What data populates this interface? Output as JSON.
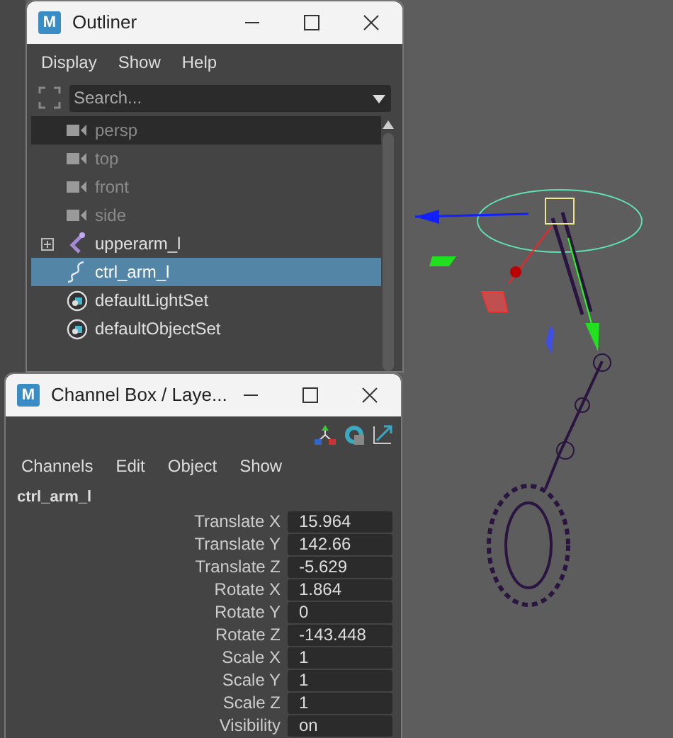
{
  "outliner": {
    "badge": "M",
    "title": "Outliner",
    "menu": [
      "Display",
      "Show",
      "Help"
    ],
    "search": {
      "placeholder": "Search..."
    },
    "items": [
      {
        "label": "persp",
        "kind": "camera",
        "hidden": true,
        "hovered": true,
        "selected": false,
        "collapsed": false
      },
      {
        "label": "top",
        "kind": "camera",
        "hidden": true,
        "hovered": false,
        "selected": false,
        "collapsed": false
      },
      {
        "label": "front",
        "kind": "camera",
        "hidden": true,
        "hovered": false,
        "selected": false,
        "collapsed": false
      },
      {
        "label": "side",
        "kind": "camera",
        "hidden": true,
        "hovered": false,
        "selected": false,
        "collapsed": false
      },
      {
        "label": "upperarm_l",
        "kind": "joint",
        "hidden": false,
        "hovered": false,
        "selected": false,
        "collapsed": true
      },
      {
        "label": "ctrl_arm_l",
        "kind": "curve",
        "hidden": false,
        "hovered": false,
        "selected": true,
        "collapsed": false
      },
      {
        "label": "defaultLightSet",
        "kind": "set",
        "hidden": false,
        "hovered": false,
        "selected": false,
        "collapsed": false
      },
      {
        "label": "defaultObjectSet",
        "kind": "set",
        "hidden": false,
        "hovered": false,
        "selected": false,
        "collapsed": false
      }
    ]
  },
  "channel_box": {
    "badge": "M",
    "title": "Channel Box / Laye...",
    "menu": [
      "Channels",
      "Edit",
      "Object",
      "Show"
    ],
    "node": "ctrl_arm_l",
    "channels": [
      {
        "name": "Translate X",
        "value": "15.964"
      },
      {
        "name": "Translate Y",
        "value": "142.66"
      },
      {
        "name": "Translate Z",
        "value": "-5.629"
      },
      {
        "name": "Rotate X",
        "value": "1.864"
      },
      {
        "name": "Rotate Y",
        "value": "0"
      },
      {
        "name": "Rotate Z",
        "value": "-143.448"
      },
      {
        "name": "Scale X",
        "value": "1"
      },
      {
        "name": "Scale Y",
        "value": "1"
      },
      {
        "name": "Scale Z",
        "value": "1"
      },
      {
        "name": "Visibility",
        "value": "on"
      }
    ]
  }
}
